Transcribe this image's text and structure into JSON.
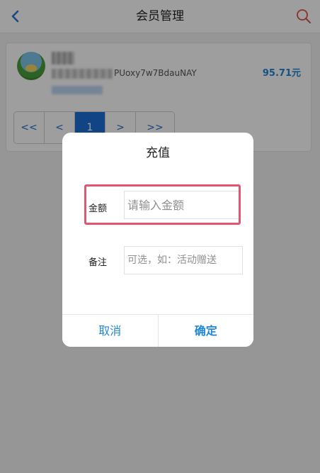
{
  "header": {
    "title": "会员管理",
    "back_icon": "chevron-left-icon",
    "search_icon": "search-icon",
    "accent": "#2a74d8",
    "search_color": "#e0504a"
  },
  "member": {
    "id_suffix": "PUoxy7w7BdauNAY",
    "balance": "95.71元"
  },
  "pagination": {
    "first": "<<",
    "prev": "<",
    "current": "1",
    "next": ">",
    "last": ">>"
  },
  "dialog": {
    "title": "充值",
    "amount_label": "金额",
    "amount_placeholder": "请输入金额",
    "amount_value": "",
    "note_label": "备注",
    "note_placeholder": "可选，如：活动赠送",
    "note_value": "",
    "cancel": "取消",
    "confirm": "确定",
    "highlight_color": "#e4566e"
  }
}
